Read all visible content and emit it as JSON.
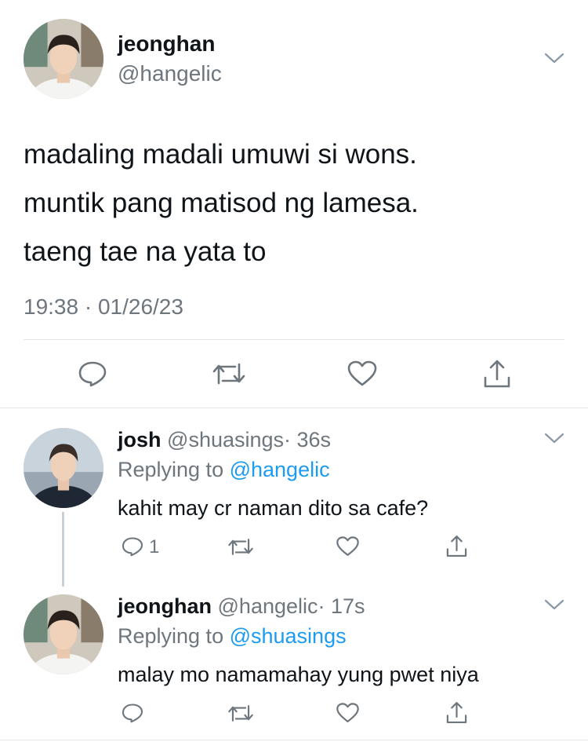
{
  "main_tweet": {
    "display_name": "jeonghan",
    "handle": "@hangelic",
    "lines": [
      "madaling madali umuwi si wons.",
      "muntik pang matisod ng lamesa.",
      "taeng tae na yata to"
    ],
    "timestamp": "19:38 · 01/26/23"
  },
  "replies": [
    {
      "display_name": "josh",
      "handle": "@shuasings",
      "time": "· 36s",
      "replying_prefix": "Replying to ",
      "replying_to": "@hangelic",
      "text": "kahit may cr naman dito sa cafe?",
      "reply_count": "1"
    },
    {
      "display_name": "jeonghan",
      "handle": "@hangelic",
      "time": "· 17s",
      "replying_prefix": "Replying to ",
      "replying_to": "@shuasings",
      "text": "malay mo namamahay yung pwet niya",
      "reply_count": ""
    }
  ],
  "colors": {
    "text": "#0f1419",
    "secondary": "#6e767d",
    "accent": "#1d9bf0",
    "divider": "#e1e5e8"
  },
  "icons": [
    "chevron-down-icon",
    "reply-icon",
    "retweet-icon",
    "like-icon",
    "share-icon"
  ]
}
